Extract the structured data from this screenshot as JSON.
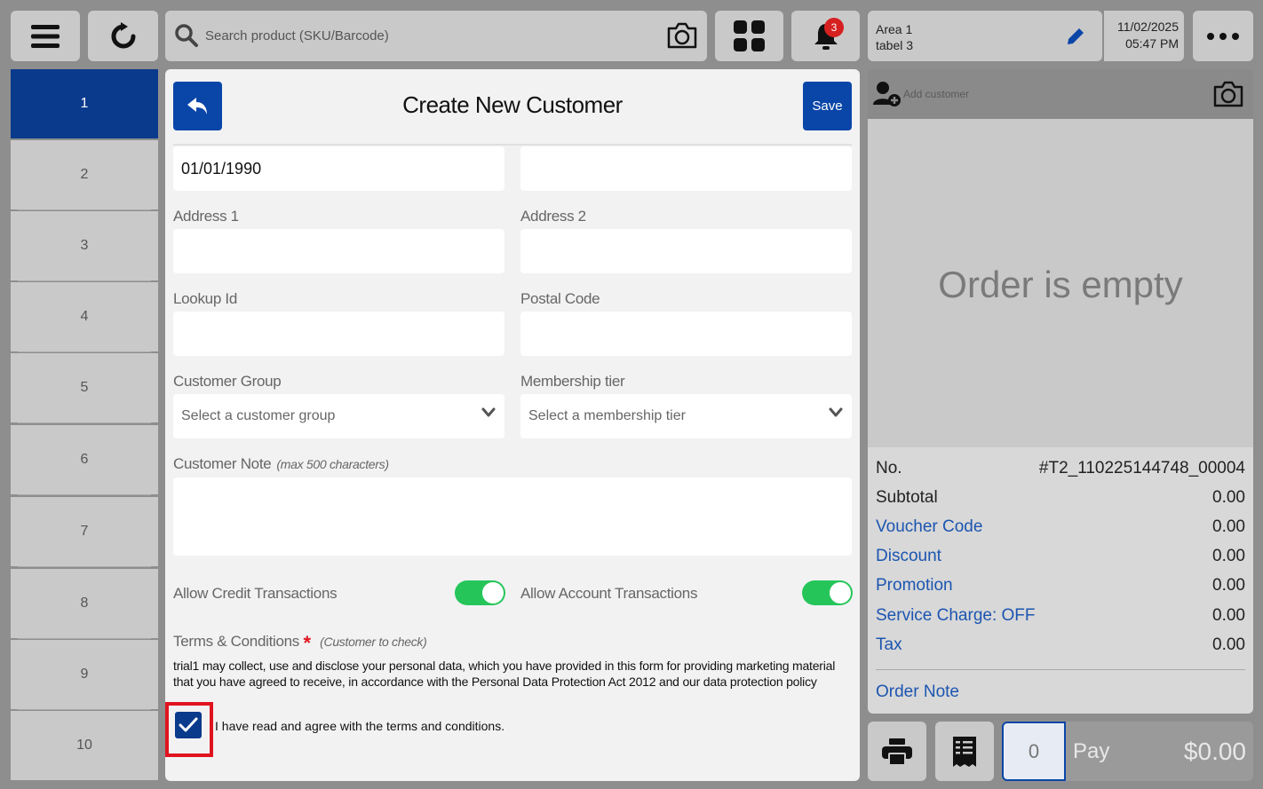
{
  "topbar": {
    "search_placeholder": "Search product (SKU/Barcode)",
    "notification_count": "3",
    "area_name": "Area 1",
    "table_name": "tabel 3",
    "date": "11/02/2025",
    "time": "05:47 PM"
  },
  "tables": [
    "1",
    "2",
    "3",
    "4",
    "5",
    "6",
    "7",
    "8",
    "9",
    "10"
  ],
  "form": {
    "title": "Create New Customer",
    "save_label": "Save",
    "dob_value": "01/01/1990",
    "address1_label": "Address 1",
    "address2_label": "Address 2",
    "lookup_label": "Lookup Id",
    "postal_label": "Postal Code",
    "group_label": "Customer Group",
    "group_placeholder": "Select a customer group",
    "tier_label": "Membership tier",
    "tier_placeholder": "Select a membership tier",
    "note_label": "Customer Note",
    "note_hint": "(max 500 characters)",
    "credit_label": "Allow Credit Transactions",
    "account_label": "Allow Account Transactions",
    "terms_label": "Terms & Conditions",
    "terms_required": "*",
    "terms_hint": "(Customer to check)",
    "terms_text": "trial1 may collect, use and disclose your personal data, which you have provided in this form for providing marketing material that you have agreed to receive, in accordance with the Personal Data Protection Act 2012 and our data protection policy",
    "agree_label": "I have read and agree with the terms and conditions."
  },
  "order": {
    "customer_placeholder": "Add customer",
    "empty_text": "Order is empty",
    "no_label": "No.",
    "no_value": "#T2_110225144748_00004",
    "rows": [
      {
        "label": "Subtotal",
        "value": "0.00",
        "blue": false
      },
      {
        "label": "Voucher Code",
        "value": "0.00",
        "blue": true
      },
      {
        "label": "Discount",
        "value": "0.00",
        "blue": true
      },
      {
        "label": "Promotion",
        "value": "0.00",
        "blue": true
      },
      {
        "label": "Service Charge: OFF",
        "value": "0.00",
        "blue": true
      },
      {
        "label": "Tax",
        "value": "0.00",
        "blue": true
      }
    ],
    "note_label": "Order Note",
    "qty": "0",
    "pay_label": "Pay",
    "pay_amount": "$0.00"
  },
  "colors": {
    "primary": "#0a46a8",
    "active_table": "#0a3a8c",
    "toggle_on": "#26c55a",
    "highlight": "#e0141e"
  }
}
